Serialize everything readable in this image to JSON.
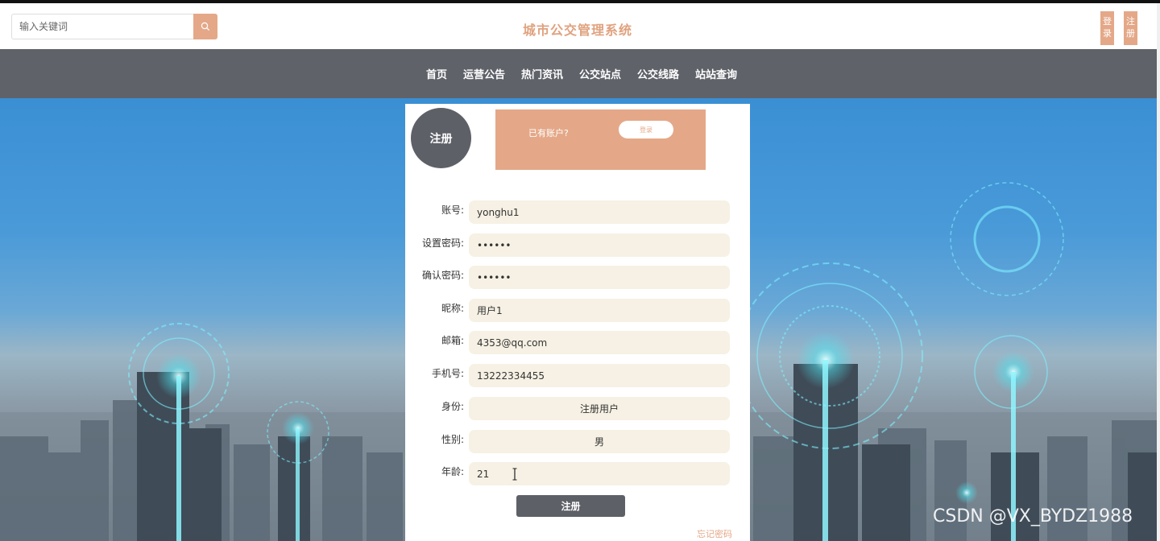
{
  "header": {
    "search_placeholder": "输入关键词",
    "site_title": "城市公交管理系统",
    "login_label": "登录",
    "register_label": "注册"
  },
  "nav": {
    "items": [
      "首页",
      "运营公告",
      "热门资讯",
      "公交站点",
      "公交线路",
      "站站查询"
    ]
  },
  "panel": {
    "circle_label": "注册",
    "has_account_text": "已有账户?",
    "login_button": "登录",
    "fields": [
      {
        "label": "账号:",
        "value": "yonghu1"
      },
      {
        "label": "设置密码:",
        "value": "••••••"
      },
      {
        "label": "确认密码:",
        "value": "••••••"
      },
      {
        "label": "昵称:",
        "value": "用户1"
      },
      {
        "label": "邮箱:",
        "value": "4353@qq.com"
      },
      {
        "label": "手机号:",
        "value": "13222334455"
      },
      {
        "label": "身份:",
        "value": "注册用户"
      },
      {
        "label": "性别:",
        "value": "男"
      },
      {
        "label": "年龄:",
        "value": "21"
      }
    ],
    "submit_label": "注册",
    "forgot_label": "忘记密码"
  },
  "watermark": "CSDN @VX_BYDZ1988",
  "colors": {
    "accent": "#e4a888",
    "nav_bg": "#5f6269",
    "title": "#e0a27f",
    "input_bg": "#f6f1e4",
    "dark_button": "#5e6068"
  }
}
